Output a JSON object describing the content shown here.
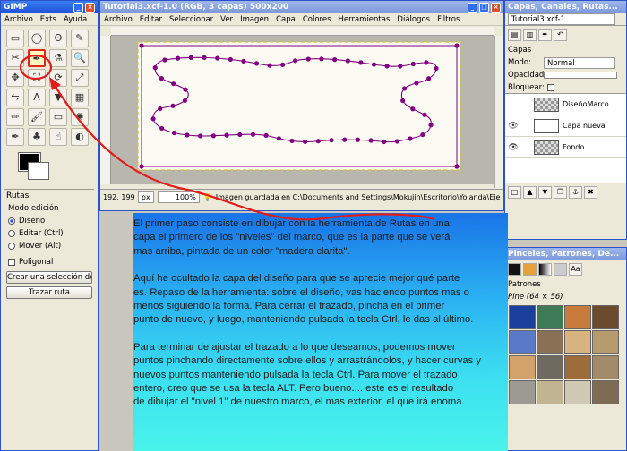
{
  "toolbox": {
    "title": "GIMP",
    "menu": [
      "Archivo",
      "Exts",
      "Ayuda"
    ],
    "tool_icons": [
      "rect-select-icon",
      "ellipse-select-icon",
      "lasso-icon",
      "fuzzy-select-icon",
      "scissors-icon",
      "paths-icon",
      "color-picker-icon",
      "zoom-icon",
      "move-icon",
      "crop-icon",
      "rotate-icon",
      "scale-icon",
      "flip-icon",
      "text-icon",
      "bucket-fill-icon",
      "blend-icon",
      "pencil-icon",
      "paintbrush-icon",
      "eraser-icon",
      "airbrush-icon",
      "ink-icon",
      "clone-icon",
      "smudge-icon",
      "dodge-icon"
    ],
    "tool_glyphs": [
      "▭",
      "◯",
      "ʘ",
      "✎",
      "✂",
      "✒",
      "⚗",
      "🔍",
      "✥",
      "⛶",
      "⟳",
      "⤢",
      "⇋",
      "A",
      "▼",
      "▦",
      "✏",
      "🖌",
      "▭",
      "✺",
      "✒",
      "♣",
      "☝",
      "◐"
    ],
    "options_title": "Rutas",
    "mode_label": "Modo edición",
    "modes": [
      "Diseño",
      "Editar (Ctrl)",
      "Mover (Alt)"
    ],
    "polygonal": "Poligonal",
    "create_selection": "Crear una selección desde la ruta",
    "stroke_path": "Trazar ruta"
  },
  "image_window": {
    "title": "Tutorial3.xcf-1.0 (RGB, 3 capas) 500x200",
    "menu": [
      "Archivo",
      "Editar",
      "Seleccionar",
      "Ver",
      "Imagen",
      "Capa",
      "Colores",
      "Herramientas",
      "Diálogos",
      "Filtros"
    ],
    "coords": "192, 199",
    "unit": "px",
    "zoom": "100%",
    "status": "Imagen guardada en C:\\Documents and Settings\\Mokujin\\Escritorio\\Yolanda\\Eje..."
  },
  "layers": {
    "title": "Capas, Canales, Rutas...",
    "image": "Tutorial3.xcf-1",
    "section": "Capas",
    "mode_label": "Modo:",
    "mode_value": "Normal",
    "opacity_label": "Opacidad:",
    "lock_label": "Bloquear:",
    "items": [
      "DiseñoMarco",
      "Capa nueva",
      "Fondo"
    ]
  },
  "patterns": {
    "title": "Pinceles, Patrones, De...",
    "section": "Patrones",
    "selected": "Pine (64 × 56)",
    "colors": [
      "#1a3f9c",
      "#3f7a57",
      "#c87b3a",
      "#6b4a2e",
      "#5a79c9",
      "#8a7055",
      "#d8b37f",
      "#b79a6e",
      "#d3a26a",
      "#6f6a5f",
      "#9e6b3a",
      "#a38a68",
      "#9c9a92",
      "#c0b590",
      "#cfc8b4",
      "#7d6b55"
    ]
  },
  "tutorial": {
    "paragraphs": [
      "El primer paso consiste en dibujar con la herramienta de Rutas en una\ncapa el primero de los \"niveles\" del marco, que es la parte que se verá\nmas arriba, pintada de un color \"madera clarita\".",
      "Aquí he ocultado la capa del diseño para que se aprecie mejor qué parte\nes.  Repaso de la herramienta: sobre el diseño, vas haciendo puntos mas o\nmenos siguiendo la forma. Para cerrar el trazado, pincha en el primer\npunto de nuevo, y luego, manteniendo pulsada la tecla Ctrl, le das al último.",
      "Para terminar de ajustar el trazado a lo que deseamos, podemos mover\npuntos pinchando directamente sobre ellos y arrastrándolos, y hacer curvas y\nnuevos puntos manteniendo pulsada la tecla Ctrl. Para mover  el trazado\nentero, creo que se usa la tecla ALT. Pero bueno.... este es el resultado\nde dibujar el \"nivel 1\" de nuestro marco, el mas exterior, el que irá enoma."
    ]
  }
}
